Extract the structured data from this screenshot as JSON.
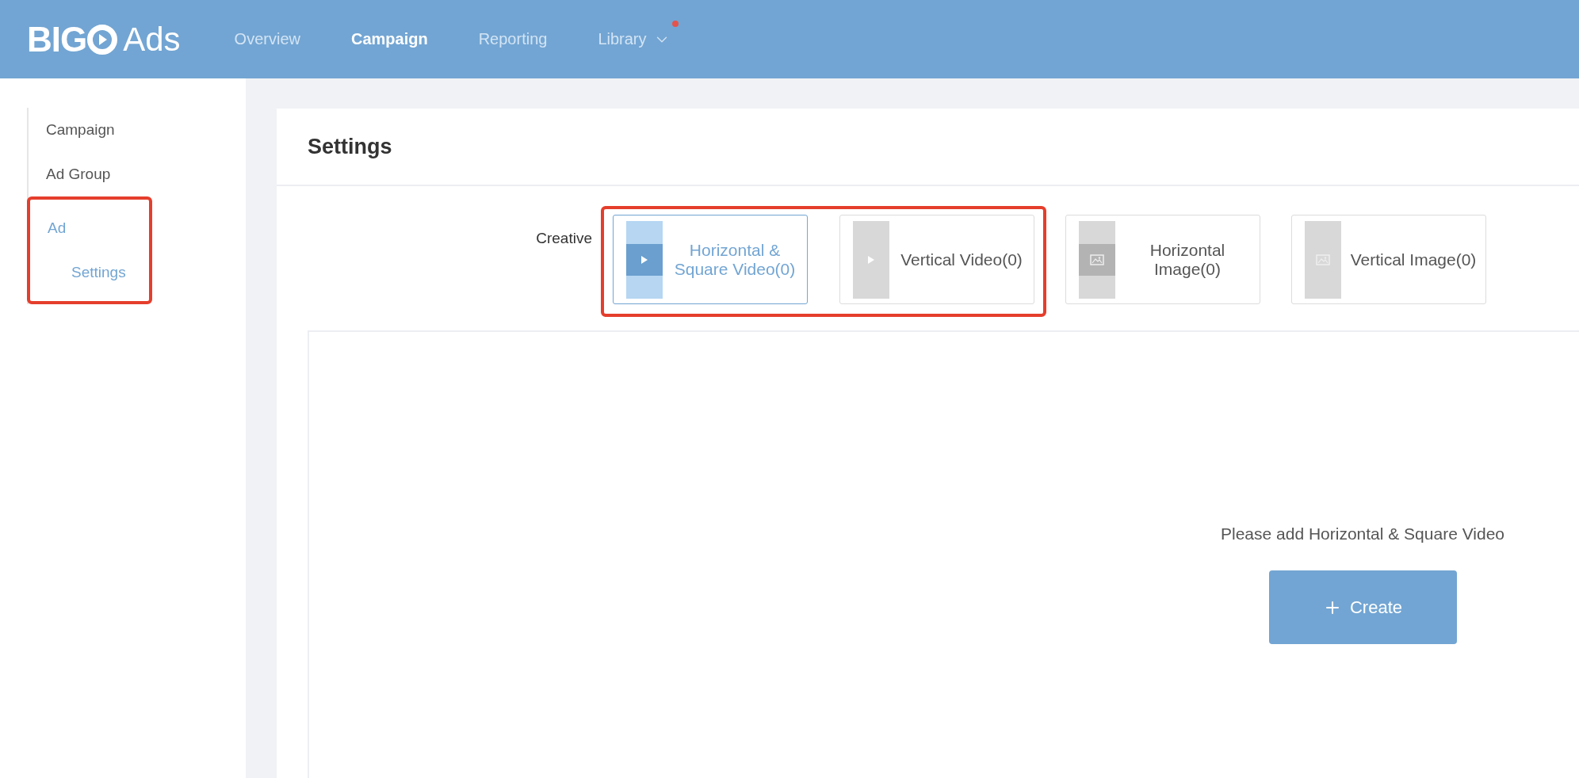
{
  "logo": {
    "mark": "BIG",
    "name": "Ads"
  },
  "nav": [
    {
      "label": "Overview",
      "selected": false
    },
    {
      "label": "Campaign",
      "selected": true
    },
    {
      "label": "Reporting",
      "selected": false
    },
    {
      "label": "Library",
      "selected": false,
      "dropdown": true,
      "dot": true
    }
  ],
  "sidebar": {
    "items": [
      {
        "label": "Campaign",
        "selected": false,
        "highlighted": false
      },
      {
        "label": "Ad Group",
        "selected": false,
        "highlighted": false
      },
      {
        "label": "Ad",
        "selected": true,
        "highlighted": true,
        "children": [
          {
            "label": "Settings",
            "selected": true
          }
        ]
      }
    ]
  },
  "panel": {
    "title": "Settings",
    "creative": {
      "label": "Creative",
      "tabs": [
        {
          "label": "Horizontal & Square Video(0)",
          "kind": "horizontal-video",
          "selected": true,
          "highlighted": true
        },
        {
          "label": "Vertical Video(0)",
          "kind": "vertical-video",
          "selected": false,
          "highlighted": true
        },
        {
          "label": "Horizontal Image(0)",
          "kind": "horizontal-image",
          "selected": false,
          "highlighted": false
        },
        {
          "label": "Vertical Image(0)",
          "kind": "vertical-image",
          "selected": false,
          "highlighted": false
        }
      ]
    },
    "empty": {
      "message": "Please add Horizontal & Square Video",
      "button": "Create"
    }
  }
}
